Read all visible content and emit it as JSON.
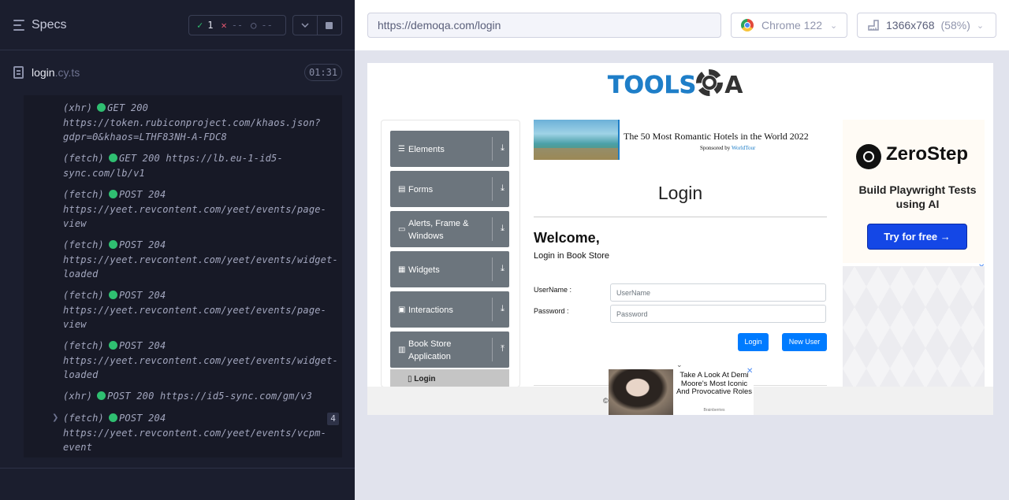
{
  "reporter": {
    "title": "Specs",
    "stats": {
      "passed": "1",
      "failed": "--",
      "pending": "--"
    },
    "spec": {
      "name": "login",
      "ext": ".cy.ts",
      "time": "01:31"
    },
    "log": [
      {
        "type": "(xhr)",
        "method": "GET 200",
        "url": "https://token.rubiconproject.com/khaos.json?",
        "url2": "gdpr=0&khaos=LTHF83NH-A-FDC8"
      },
      {
        "type": "(fetch)",
        "method": "GET 200",
        "url": "https://lb.eu-1-id5-",
        "url2": "sync.com/lb/v1"
      },
      {
        "type": "(fetch)",
        "method": "POST 204",
        "url": "",
        "url2": "https://yeet.revcontent.com/yeet/events/page-",
        "url3": "view"
      },
      {
        "type": "(fetch)",
        "method": "POST 204",
        "url": "",
        "url2": "https://yeet.revcontent.com/yeet/events/widget-",
        "url3": "loaded"
      },
      {
        "type": "(fetch)",
        "method": "POST 204",
        "url": "",
        "url2": "https://yeet.revcontent.com/yeet/events/page-",
        "url3": "view"
      },
      {
        "type": "(fetch)",
        "method": "POST 204",
        "url": "",
        "url2": "https://yeet.revcontent.com/yeet/events/widget-",
        "url3": "loaded"
      },
      {
        "type": "(xhr)",
        "method": "POST 200",
        "url": "https://id5-sync.com/gm/v3"
      },
      {
        "type": "(fetch)",
        "method": "POST 204",
        "url": "",
        "url2": "https://yeet.revcontent.com/yeet/events/vcpm-",
        "url3": "event",
        "badge": "4"
      }
    ]
  },
  "aut": {
    "url": "https://demoqa.com/login",
    "browser": "Chrome 122",
    "viewport": "1366x768",
    "viewport_pct": "(58%)"
  },
  "page": {
    "logo_tools": "TOOLS",
    "logo_a": "A",
    "menu": [
      {
        "icon": "☰",
        "label": "Elements",
        "arrow": "⤓"
      },
      {
        "icon": "▤",
        "label": "Forms",
        "arrow": "⤓"
      },
      {
        "icon": "▭",
        "label": "Alerts, Frame & Windows",
        "arrow": "⤓"
      },
      {
        "icon": "▦",
        "label": "Widgets",
        "arrow": "⤓"
      },
      {
        "icon": "▣",
        "label": "Interactions",
        "arrow": "⤓"
      },
      {
        "icon": "▥",
        "label": "Book Store Application",
        "arrow": "⤒"
      }
    ],
    "menu_sub_login": "Login",
    "hotel_ad": {
      "title": "The 50 Most Romantic Hotels in the World 2022",
      "sponsor_prefix": "Sponsored by ",
      "sponsor": "WorldTour"
    },
    "login_heading": "Login",
    "welcome": "Welcome,",
    "welcome_sub": "Login in Book Store",
    "username_label": "UserName :",
    "password_label": "Password :",
    "username_placeholder": "UserName",
    "password_placeholder": "Password",
    "login_button": "Login",
    "new_user_button": "New User",
    "zerostep": {
      "name": "ZeroStep",
      "tagline": "Build Playwright Tests using AI",
      "button": "Try for free →"
    },
    "bottom_ad": {
      "text": "Take A Look At Demi Moore's Most Iconic And Provocative Roles",
      "brand": "Brainberries",
      "close": "✕"
    },
    "ad_close": "✕",
    "footer_left": "©",
    "footer_right": "."
  }
}
